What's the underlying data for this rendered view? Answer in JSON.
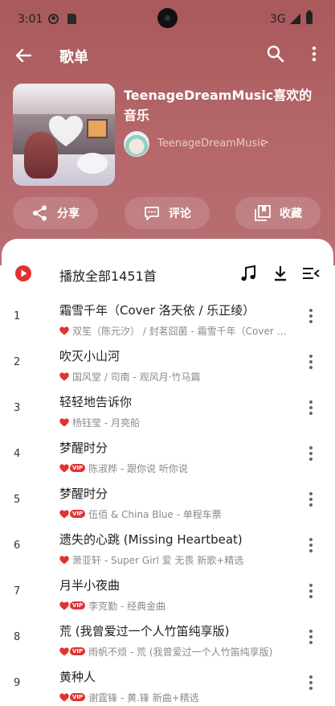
{
  "status": {
    "time": "3:01",
    "network": "3G"
  },
  "appbar": {
    "title": "歌单"
  },
  "playlist": {
    "title": "TeenageDreamMusic喜欢的音乐",
    "creator": "TeenageDreamMusic",
    "chevron": ">"
  },
  "actions": {
    "share": "分享",
    "comment": "评论",
    "collect": "收藏"
  },
  "playall": {
    "label": "播放全部1451首"
  },
  "colors": {
    "accent": "#e03232",
    "header": "#b0605f"
  },
  "songs": [
    {
      "index": "1",
      "title": "霜雪千年（Cover 洛天依 / 乐正绫）",
      "artist": "双笙（陈元汐） / 封茗囧菌 - 霜雪千年（Cover 洛天依 / 乐正绫）",
      "vip": false
    },
    {
      "index": "2",
      "title": "吹灭小山河",
      "artist": "国风堂 / 司南 - 观风月·竹马篇",
      "vip": false
    },
    {
      "index": "3",
      "title": "轻轻地告诉你",
      "artist": "杨钰莹 - 月亮船",
      "vip": false
    },
    {
      "index": "4",
      "title": "梦醒时分",
      "artist": "陈淑桦 - 跟你说 听你说",
      "vip": true
    },
    {
      "index": "5",
      "title": "梦醒时分",
      "artist": "伍佰 & China Blue - 单程车票",
      "vip": true
    },
    {
      "index": "6",
      "title": "遗失的心跳 (Missing Heartbeat)",
      "artist": "萧亚轩 - Super Girl 爱 无畏 新歌+精选",
      "vip": false
    },
    {
      "index": "7",
      "title": "月半小夜曲",
      "artist": "李克勤 - 经典金曲",
      "vip": true
    },
    {
      "index": "8",
      "title": "荒 (我曾爱过一个人竹笛纯享版)",
      "artist": "雨帆不烦 - 荒 (我曾爱过一个人竹笛纯享版)",
      "vip": true
    },
    {
      "index": "9",
      "title": "黄种人",
      "artist": "谢霆锋 - 黄.锋 新曲+精选",
      "vip": true
    }
  ],
  "vip_label": "VIP"
}
